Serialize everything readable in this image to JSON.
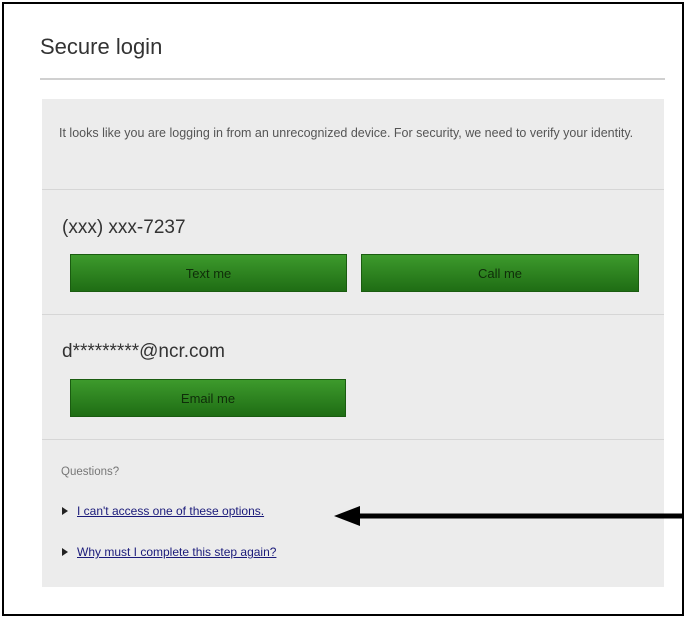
{
  "header": {
    "title": "Secure login"
  },
  "panel": {
    "intro_text": "It looks like you are logging in from an unrecognized device. For security, we need to verify your identity.",
    "phone": {
      "number": "(xxx) xxx-7237",
      "text_button_label": "Text me",
      "call_button_label": "Call me"
    },
    "email": {
      "address": "d*********@ncr.com",
      "email_button_label": "Email me"
    },
    "questions": {
      "heading": "Questions?",
      "links": [
        {
          "label": "I can't access one of these options."
        },
        {
          "label": "Why must I complete this step again?"
        }
      ]
    }
  },
  "colors": {
    "button_green": "#2a8a1c",
    "panel_bg": "#ececec",
    "link": "#1a1a7a"
  },
  "icons": {
    "bullet": "triangle-right-icon",
    "annotation": "arrow-left-icon"
  }
}
